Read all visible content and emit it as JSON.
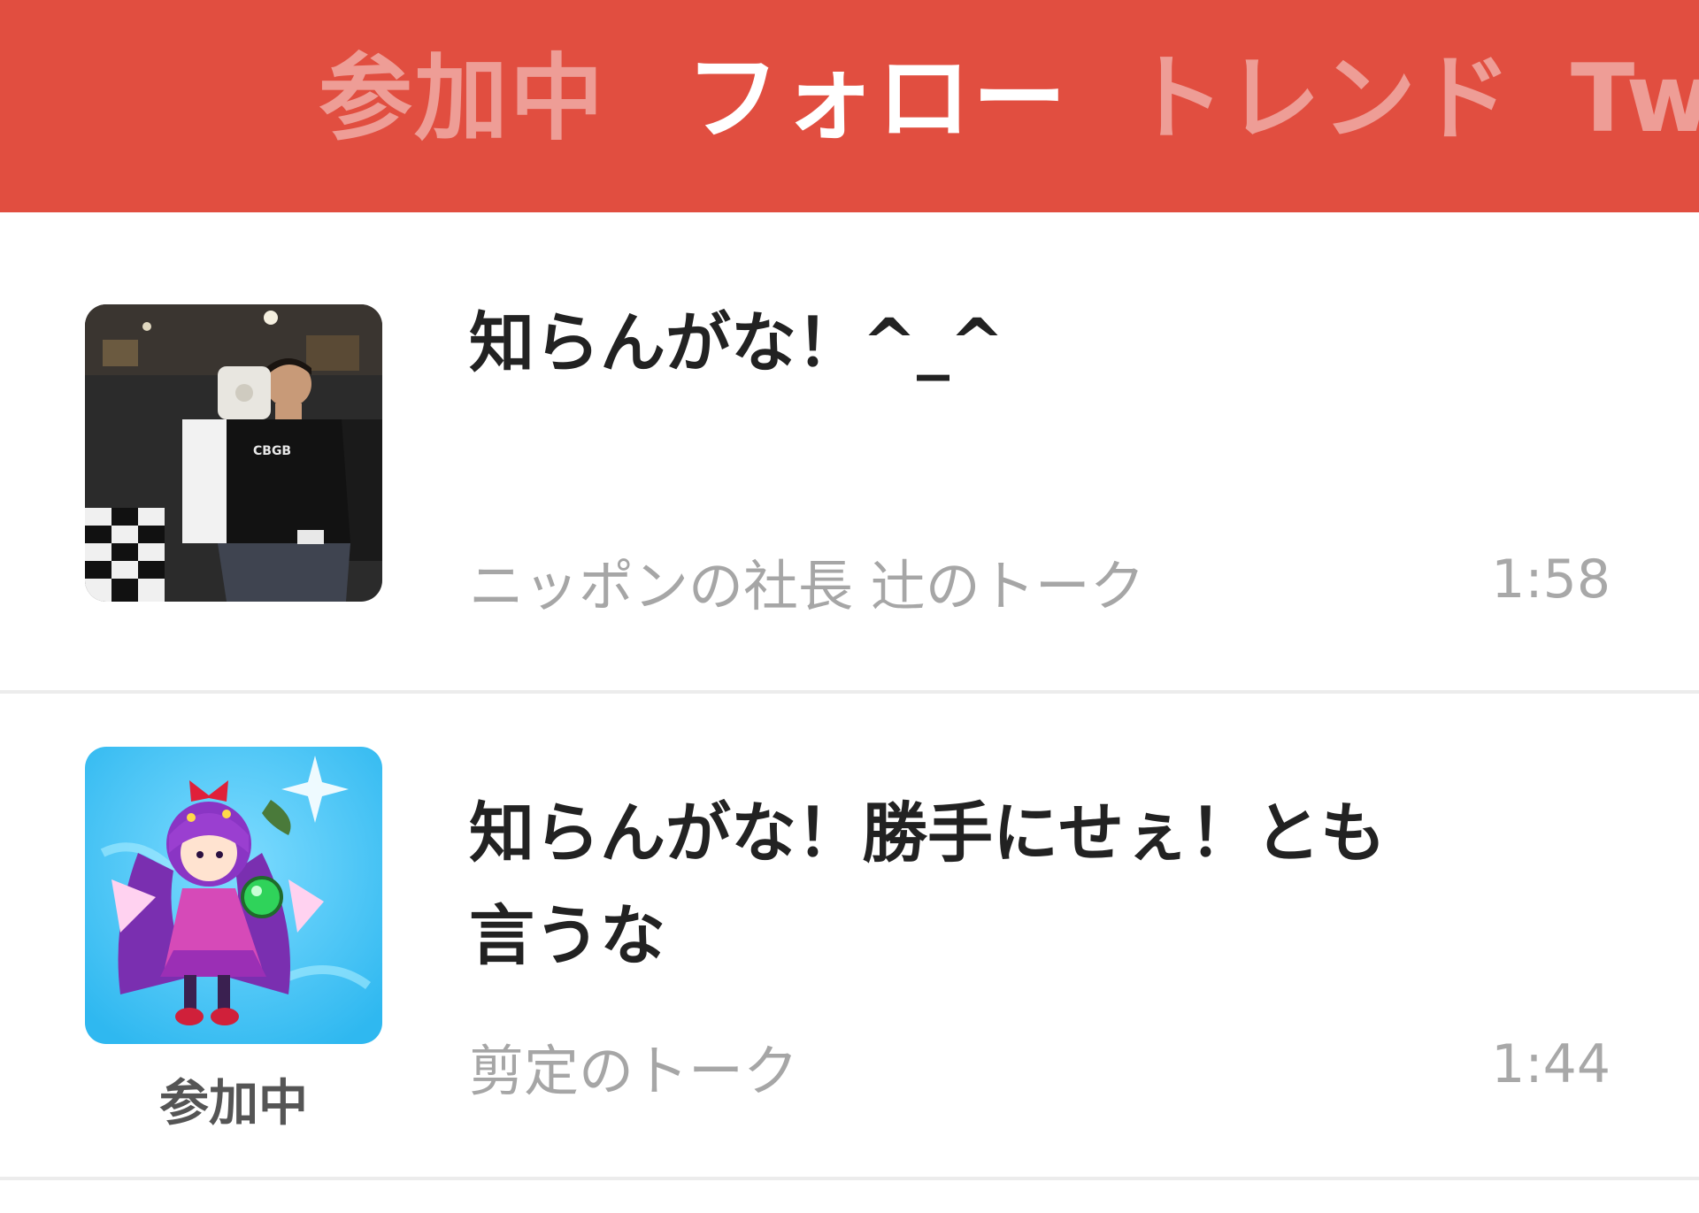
{
  "header": {
    "background": "#e14e40",
    "tabs": [
      {
        "label": "参加中",
        "active": false
      },
      {
        "label": "フォロー",
        "active": true
      },
      {
        "label": "トレンド",
        "active": false
      },
      {
        "label": "Tw",
        "active": false
      }
    ]
  },
  "feed": [
    {
      "title": "知らんがな！^_^",
      "subtitle": "ニッポンの社長 辻のトーク",
      "time": "1:58",
      "thumbnail": "photo-person-in-black-tshirt",
      "joined_label": ""
    },
    {
      "title": "知らんがな！勝手にせぇ！とも言うな",
      "subtitle": "剪定のトーク",
      "time": "1:44",
      "thumbnail": "anime-witch-character-icon",
      "joined_label": "参加中"
    }
  ]
}
